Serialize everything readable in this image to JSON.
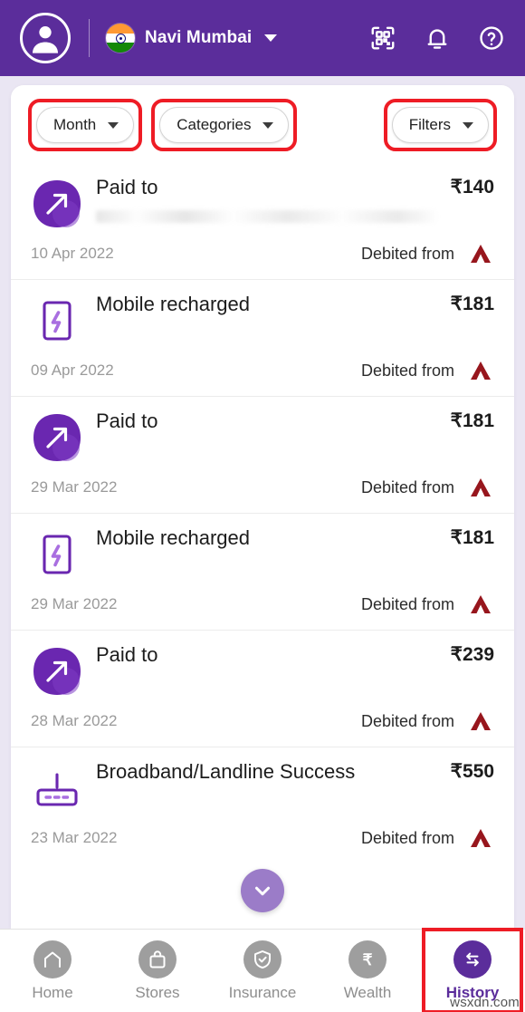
{
  "header": {
    "avatar_icon": "user-avatar-icon",
    "location": "Navi Mumbai",
    "location_caret_icon": "chevron-down-icon",
    "flag_icon": "india-flag-icon",
    "actions": [
      {
        "name": "qr-scan-icon",
        "label": "Scan QR"
      },
      {
        "name": "bell-icon",
        "label": "Notifications"
      },
      {
        "name": "help-icon",
        "label": "Help"
      }
    ]
  },
  "filters": {
    "month": {
      "label": "Month",
      "annotated": true
    },
    "categories": {
      "label": "Categories",
      "annotated": true
    },
    "filters": {
      "label": "Filters",
      "annotated": true
    },
    "caret_icon": "chevron-down-icon"
  },
  "transactions": [
    {
      "icon": "arrow-up-right-icon",
      "title": "Paid to",
      "subtitle_redacted": true,
      "amount": "₹140",
      "date": "10 Apr 2022",
      "source_label": "Debited from",
      "bank": "axis-bank-logo"
    },
    {
      "icon": "mobile-recharge-icon",
      "title": "Mobile recharged",
      "subtitle_redacted": false,
      "amount": "₹181",
      "date": "09 Apr 2022",
      "source_label": "Debited from",
      "bank": "axis-bank-logo"
    },
    {
      "icon": "arrow-up-right-icon",
      "title": "Paid to",
      "subtitle_redacted": false,
      "amount": "₹181",
      "date": "29 Mar 2022",
      "source_label": "Debited from",
      "bank": "axis-bank-logo"
    },
    {
      "icon": "mobile-recharge-icon",
      "title": "Mobile recharged",
      "subtitle_redacted": false,
      "amount": "₹181",
      "date": "29 Mar 2022",
      "source_label": "Debited from",
      "bank": "axis-bank-logo"
    },
    {
      "icon": "arrow-up-right-icon",
      "title": "Paid to",
      "subtitle_redacted": false,
      "amount": "₹239",
      "date": "28 Mar 2022",
      "source_label": "Debited from",
      "bank": "axis-bank-logo"
    },
    {
      "icon": "router-icon",
      "title": "Broadband/Landline Success",
      "subtitle_redacted": false,
      "amount": "₹550",
      "date": "23 Mar 2022",
      "source_label": "Debited from",
      "bank": "axis-bank-logo"
    }
  ],
  "scroll_fab": {
    "icon": "chevron-down-icon"
  },
  "bottom_nav": {
    "items": [
      {
        "label": "Home",
        "icon": "home-icon",
        "active": false,
        "annotated": false
      },
      {
        "label": "Stores",
        "icon": "store-bag-icon",
        "active": false,
        "annotated": false
      },
      {
        "label": "Insurance",
        "icon": "shield-check-icon",
        "active": false,
        "annotated": false
      },
      {
        "label": "Wealth",
        "icon": "rupee-icon",
        "active": false,
        "annotated": false
      },
      {
        "label": "History",
        "icon": "exchange-arrows-icon",
        "active": true,
        "annotated": true
      }
    ]
  },
  "watermark": "wsxdn.com",
  "colors": {
    "brand_purple": "#5b2d9b",
    "page_bg": "#eae6f3",
    "annotation_red": "#ee1c25",
    "bank_maroon": "#97161d",
    "fab_purple": "#9b7cc8"
  }
}
